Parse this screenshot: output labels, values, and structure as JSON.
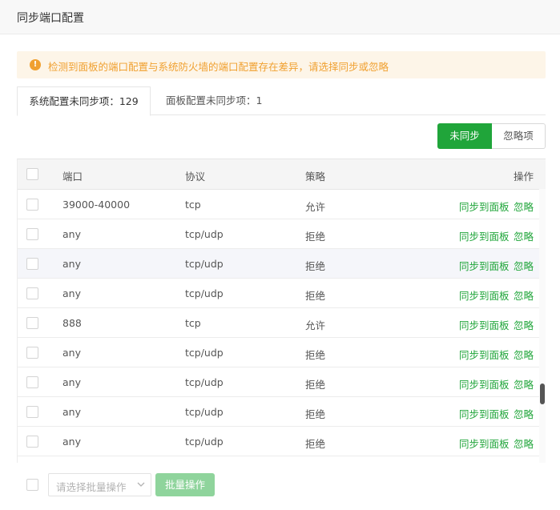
{
  "dialog": {
    "title": "同步端口配置"
  },
  "alert": {
    "icon": "warning-circle-icon",
    "text": "检测到面板的端口配置与系统防火墙的端口配置存在差异，请选择同步或忽略",
    "color": "#f0a030"
  },
  "tabs": [
    {
      "label": "系统配置未同步项：129",
      "active": true
    },
    {
      "label": "面板配置未同步项：1",
      "active": false
    }
  ],
  "filter": {
    "unsynced_label": "未同步",
    "ignored_label": "忽略项",
    "accent": "#20a53a"
  },
  "table": {
    "headers": {
      "port": "端口",
      "protocol": "协议",
      "policy": "策略",
      "actions": "操作"
    },
    "rows": [
      {
        "port": "39000-40000",
        "protocol": "tcp",
        "policy": "允许",
        "sync": "同步到面板",
        "ignore": "忽略"
      },
      {
        "port": "any",
        "protocol": "tcp/udp",
        "policy": "拒绝",
        "sync": "同步到面板",
        "ignore": "忽略"
      },
      {
        "port": "any",
        "protocol": "tcp/udp",
        "policy": "拒绝",
        "sync": "同步到面板",
        "ignore": "忽略"
      },
      {
        "port": "any",
        "protocol": "tcp/udp",
        "policy": "拒绝",
        "sync": "同步到面板",
        "ignore": "忽略"
      },
      {
        "port": "888",
        "protocol": "tcp",
        "policy": "允许",
        "sync": "同步到面板",
        "ignore": "忽略"
      },
      {
        "port": "any",
        "protocol": "tcp/udp",
        "policy": "拒绝",
        "sync": "同步到面板",
        "ignore": "忽略"
      },
      {
        "port": "any",
        "protocol": "tcp/udp",
        "policy": "拒绝",
        "sync": "同步到面板",
        "ignore": "忽略"
      },
      {
        "port": "any",
        "protocol": "tcp/udp",
        "policy": "拒绝",
        "sync": "同步到面板",
        "ignore": "忽略"
      },
      {
        "port": "any",
        "protocol": "tcp/udp",
        "policy": "拒绝",
        "sync": "同步到面板",
        "ignore": "忽略"
      }
    ]
  },
  "footer": {
    "batch_placeholder": "请选择批量操作",
    "batch_button": "批量操作"
  }
}
